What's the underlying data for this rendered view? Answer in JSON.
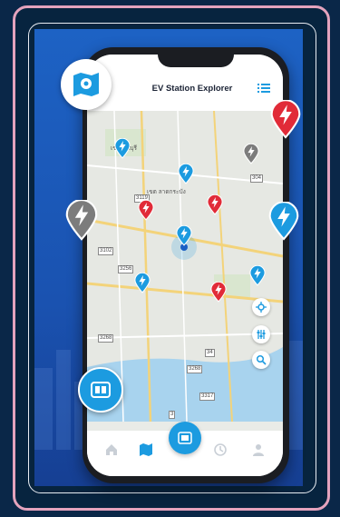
{
  "app": {
    "title": "EV Station Explorer"
  },
  "map": {
    "area_labels": [
      "เขต มีนบุรี",
      "เขต ลาดกระบัง"
    ],
    "road_labels": [
      "3119",
      "3102",
      "3256",
      "304",
      "3268",
      "34",
      "3268",
      "3256",
      "3317",
      "3"
    ]
  },
  "pins": {
    "blue_count": 6,
    "red_count": 4,
    "gray_count": 2
  },
  "tabs": [
    "home-icon",
    "map-icon",
    "station-icon",
    "history-icon",
    "profile-icon"
  ],
  "colors": {
    "primary": "#1c9be0",
    "red": "#e12b38",
    "gray": "#7c7c7c",
    "frame": "#e4a3bd"
  }
}
